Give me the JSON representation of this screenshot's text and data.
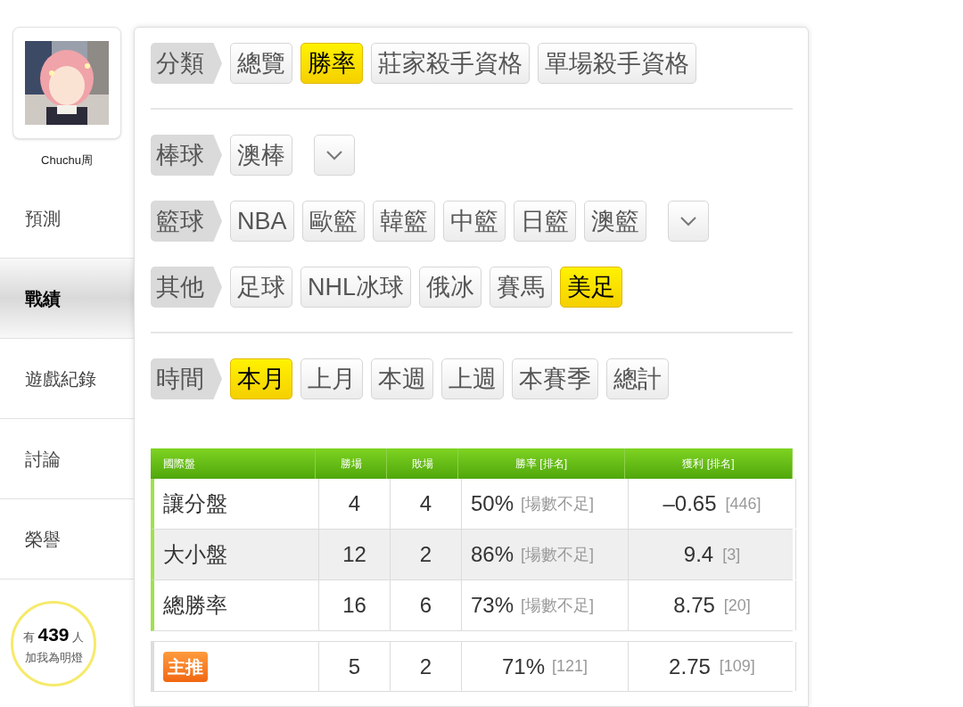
{
  "profile": {
    "name": "Chuchu周"
  },
  "nav": [
    {
      "label": "預測",
      "selected": false
    },
    {
      "label": "戰績",
      "selected": true
    },
    {
      "label": "遊戲紀錄",
      "selected": false
    },
    {
      "label": "討論",
      "selected": false
    },
    {
      "label": "榮譽",
      "selected": false
    }
  ],
  "fans": {
    "prefix": "有",
    "count": "439",
    "suffix": "人",
    "caption": "加我為明燈"
  },
  "filter_sections": [
    [
      {
        "label": "分類",
        "dropdown": false,
        "options": [
          {
            "label": "總覽",
            "selected": false
          },
          {
            "label": "勝率",
            "selected": true
          },
          {
            "label": "莊家殺手資格",
            "selected": false
          },
          {
            "label": "單場殺手資格",
            "selected": false
          }
        ]
      }
    ],
    [
      {
        "label": "棒球",
        "dropdown": true,
        "options": [
          {
            "label": "澳棒",
            "selected": false
          }
        ]
      },
      {
        "label": "籃球",
        "dropdown": true,
        "options": [
          {
            "label": "NBA",
            "selected": false
          },
          {
            "label": "歐籃",
            "selected": false
          },
          {
            "label": "韓籃",
            "selected": false
          },
          {
            "label": "中籃",
            "selected": false
          },
          {
            "label": "日籃",
            "selected": false
          },
          {
            "label": "澳籃",
            "selected": false
          }
        ]
      },
      {
        "label": "其他",
        "dropdown": false,
        "options": [
          {
            "label": "足球",
            "selected": false
          },
          {
            "label": "NHL冰球",
            "selected": false
          },
          {
            "label": "俄冰",
            "selected": false
          },
          {
            "label": "賽馬",
            "selected": false
          },
          {
            "label": "美足",
            "selected": true
          }
        ]
      }
    ],
    [
      {
        "label": "時間",
        "dropdown": false,
        "options": [
          {
            "label": "本月",
            "selected": true
          },
          {
            "label": "上月",
            "selected": false
          },
          {
            "label": "本週",
            "selected": false
          },
          {
            "label": "上週",
            "selected": false
          },
          {
            "label": "本賽季",
            "selected": false
          },
          {
            "label": "總計",
            "selected": false
          }
        ]
      }
    ]
  ],
  "table": {
    "columns": [
      "國際盤",
      "勝場",
      "敗場",
      "勝率 [排名]",
      "獲利 [排名]"
    ],
    "rows": [
      {
        "kind": "market",
        "name": "讓分盤",
        "wins": "4",
        "losses": "4",
        "rate": "50%",
        "rate_rank": "[場數不足]",
        "profit": "–0.65",
        "profit_rank": "[446]"
      },
      {
        "kind": "market",
        "name": "大小盤",
        "wins": "12",
        "losses": "2",
        "rate": "86%",
        "rate_rank": "[場數不足]",
        "profit": "9.4",
        "profit_rank": "[3]"
      },
      {
        "kind": "market",
        "name": "總勝率",
        "wins": "16",
        "losses": "6",
        "rate": "73%",
        "rate_rank": "[場數不足]",
        "profit": "8.75",
        "profit_rank": "[20]"
      },
      {
        "kind": "featured",
        "name": "主推",
        "wins": "5",
        "losses": "2",
        "rate": "71%",
        "rate_rank": "[121]",
        "profit": "2.75",
        "profit_rank": "[109]"
      }
    ]
  }
}
